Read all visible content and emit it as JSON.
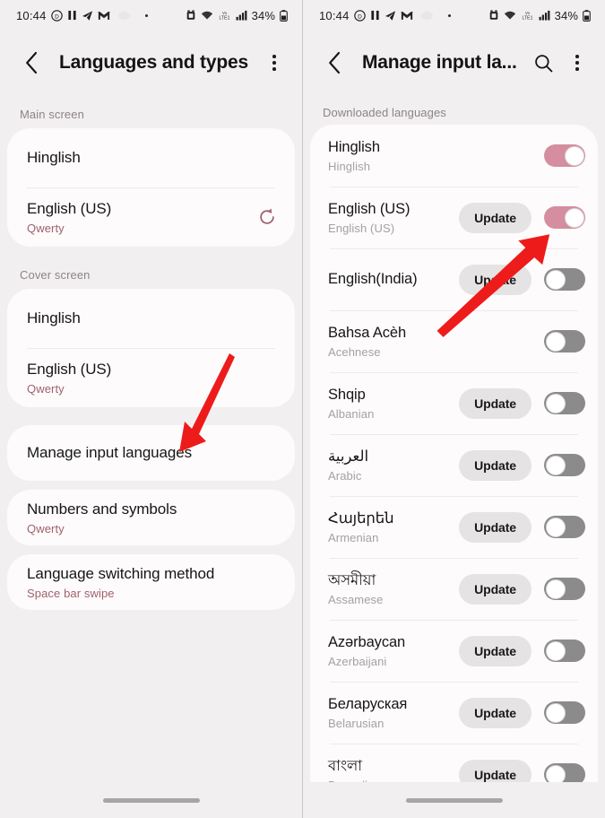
{
  "status_bar": {
    "time": "10:44",
    "battery_text": "34%",
    "network_text": "LTE1",
    "left_icons": [
      "pause-circle-icon",
      "pause-icon",
      "telegram-icon",
      "gmail-icon",
      "cloud-icon",
      "dot-icon"
    ],
    "right_icons": [
      "alarm-icon",
      "wifi-icon",
      "volte-icon",
      "signal-icon",
      "battery-icon"
    ]
  },
  "left_panel": {
    "appbar": {
      "back_label": "Back",
      "title": "Languages and types",
      "more_label": "More options"
    },
    "sections": [
      {
        "label": "Main screen",
        "rows": [
          {
            "title": "Hinglish",
            "subtitle": "",
            "has_refresh": false
          },
          {
            "title": "English (US)",
            "subtitle": "Qwerty",
            "has_refresh": true
          }
        ]
      },
      {
        "label": "Cover screen",
        "rows": [
          {
            "title": "Hinglish",
            "subtitle": "",
            "has_refresh": false
          },
          {
            "title": "English (US)",
            "subtitle": "Qwerty",
            "has_refresh": false
          }
        ]
      }
    ],
    "options": [
      {
        "title": "Manage input languages",
        "subtitle": ""
      },
      {
        "title": "Numbers and symbols",
        "subtitle": "Qwerty"
      },
      {
        "title": "Language switching method",
        "subtitle": "Space bar swipe"
      }
    ]
  },
  "right_panel": {
    "appbar": {
      "back_label": "Back",
      "title": "Manage input la...",
      "search_label": "Search",
      "more_label": "More options"
    },
    "section_label": "Downloaded languages",
    "update_label": "Update",
    "languages": [
      {
        "native": "Hinglish",
        "english": "Hinglish",
        "update": false,
        "toggle": "on"
      },
      {
        "native": "English (US)",
        "english": "English (US)",
        "update": true,
        "toggle": "on"
      },
      {
        "native": "English(India)",
        "english": "",
        "update": true,
        "toggle": "off"
      },
      {
        "native": "Bahsa Acèh",
        "english": "Acehnese",
        "update": false,
        "toggle": "off"
      },
      {
        "native": "Shqip",
        "english": "Albanian",
        "update": true,
        "toggle": "off"
      },
      {
        "native": "العربية",
        "english": "Arabic",
        "update": true,
        "toggle": "off"
      },
      {
        "native": "Հայերեն",
        "english": "Armenian",
        "update": true,
        "toggle": "off"
      },
      {
        "native": "অসমীয়া",
        "english": "Assamese",
        "update": true,
        "toggle": "off"
      },
      {
        "native": "Azərbaycan",
        "english": "Azerbaijani",
        "update": true,
        "toggle": "off"
      },
      {
        "native": "Беларуская",
        "english": "Belarusian",
        "update": true,
        "toggle": "off"
      },
      {
        "native": "বাংলা",
        "english": "Bengali",
        "update": true,
        "toggle": "off"
      }
    ]
  },
  "annotations": {
    "left_arrow_name": "red-arrow-pointing-to-manage-input-languages",
    "right_arrow_name": "red-arrow-pointing-to-english-us-toggle",
    "color": "#ee1b1b"
  },
  "colors": {
    "background": "#f2eff0",
    "card": "#fdfbfc",
    "accent_pink": "#a0616e",
    "toggle_on": "#d48e9f",
    "toggle_off": "#8b8b8b",
    "arrow_red": "#ee1b1b"
  }
}
